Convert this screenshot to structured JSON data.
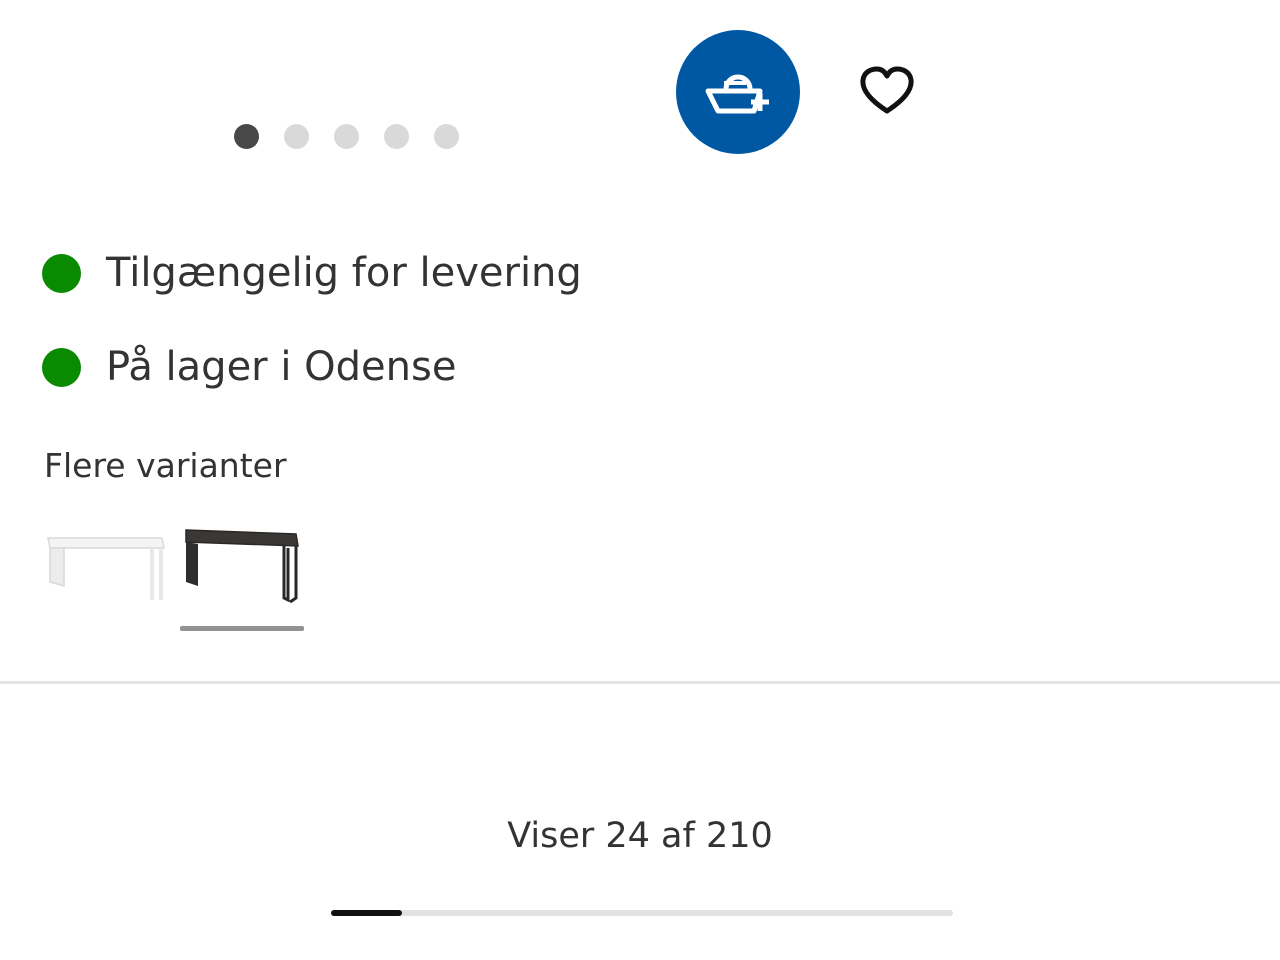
{
  "carousel": {
    "dot_count": 5,
    "active_index": 0
  },
  "actions": {
    "add_to_basket_icon": "basket-plus-icon",
    "favourite_icon": "heart-icon",
    "accent_color": "#0058a3"
  },
  "availability": [
    {
      "status_color": "#0a8a00",
      "text": "Tilgængelig for levering"
    },
    {
      "status_color": "#0a8a00",
      "text": "På lager i Odense"
    }
  ],
  "variants": {
    "title": "Flere varianter",
    "items": [
      {
        "color": "white",
        "selected": false
      },
      {
        "color": "black-brown",
        "selected": true
      }
    ]
  },
  "pagination": {
    "text": "Viser 24 af 210",
    "shown": 24,
    "total": 210,
    "progress_fraction": 0.114
  }
}
